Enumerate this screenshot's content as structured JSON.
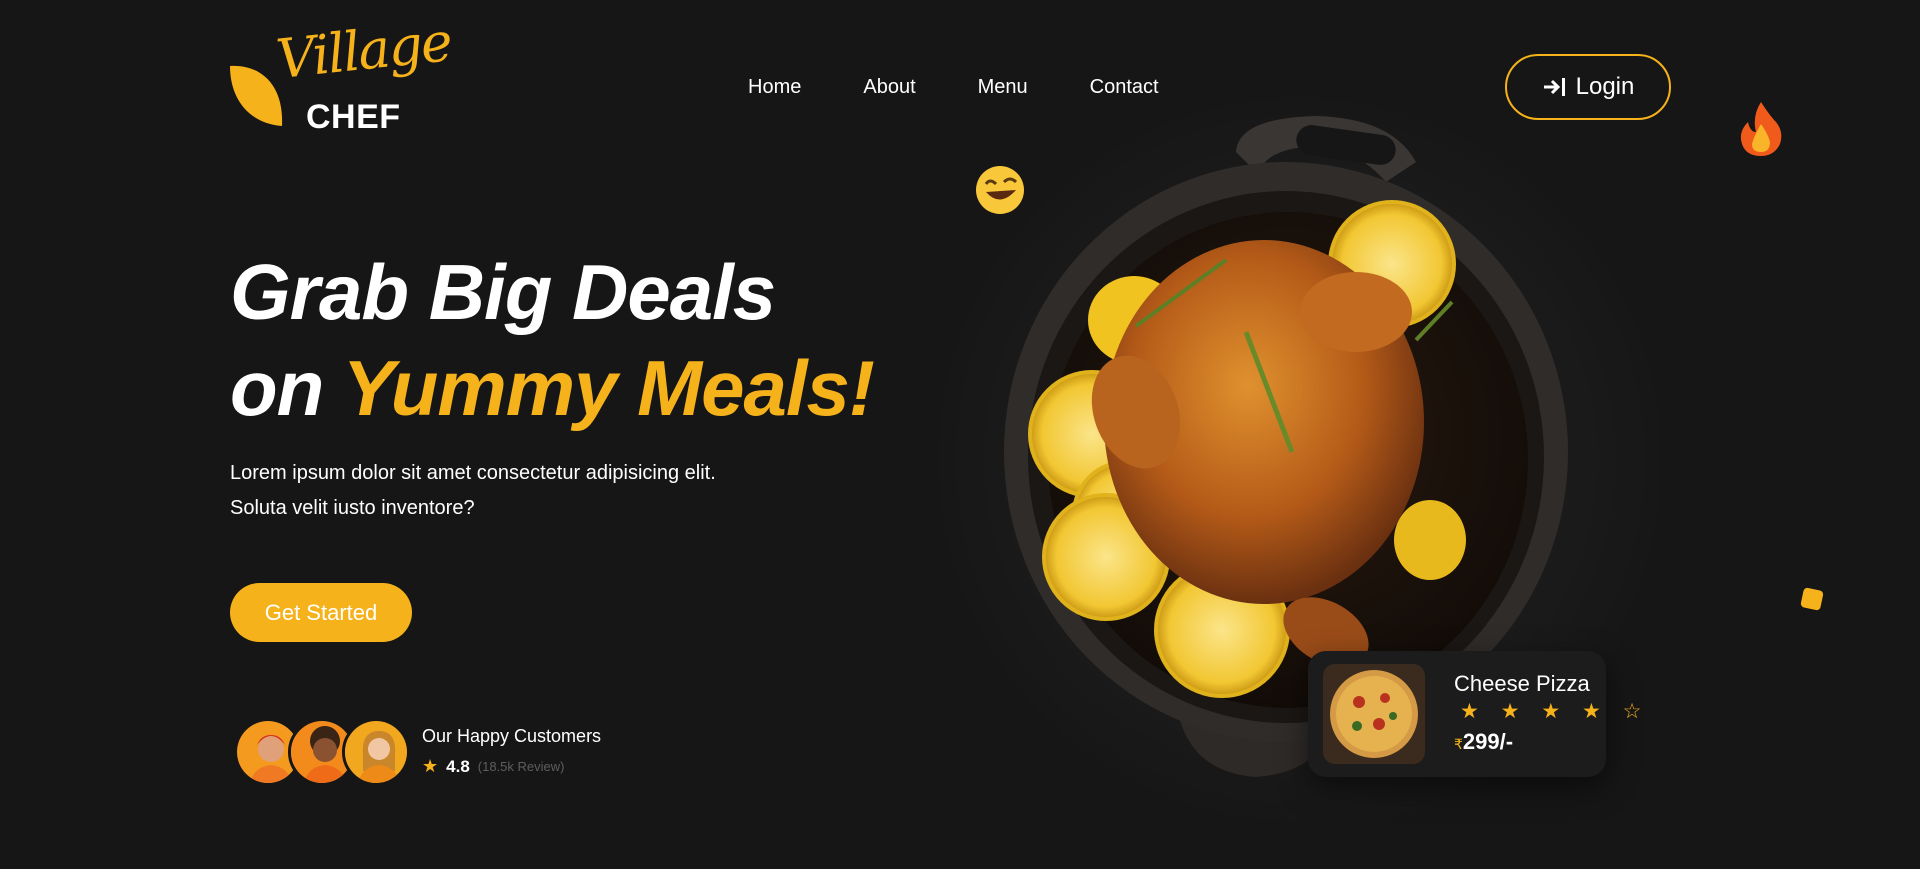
{
  "brand": {
    "script": "Village",
    "word": "CHEF",
    "accent_color": "#f5b21a",
    "background_color": "#161616"
  },
  "nav": {
    "items": [
      {
        "label": "Home"
      },
      {
        "label": "About"
      },
      {
        "label": "Menu"
      },
      {
        "label": "Contact"
      }
    ],
    "login_label": "Login",
    "login_icon": "login-icon"
  },
  "hero": {
    "line1": "Grab Big Deals",
    "line2_prefix": "on",
    "line2_accent": "Yummy Meals!",
    "desc_line1": "Lorem ipsum dolor sit amet consectetur adipisicing elit.",
    "desc_line2": "Soluta velit iusto inventore?",
    "cta_label": "Get Started"
  },
  "customers": {
    "title": "Our Happy Customers",
    "rating": "4.8",
    "reviews": "(18.5k Review)",
    "star_icon": "star-icon"
  },
  "featured": {
    "name": "Cheese Pizza",
    "rating_stars": 4,
    "rating_max": 5,
    "stars_text": "★ ★ ★ ★ ☆",
    "currency": "₹",
    "price": "299/-"
  },
  "decorations": {
    "emoji_left": "grinning-face-icon",
    "emoji_right": "fire-icon"
  }
}
